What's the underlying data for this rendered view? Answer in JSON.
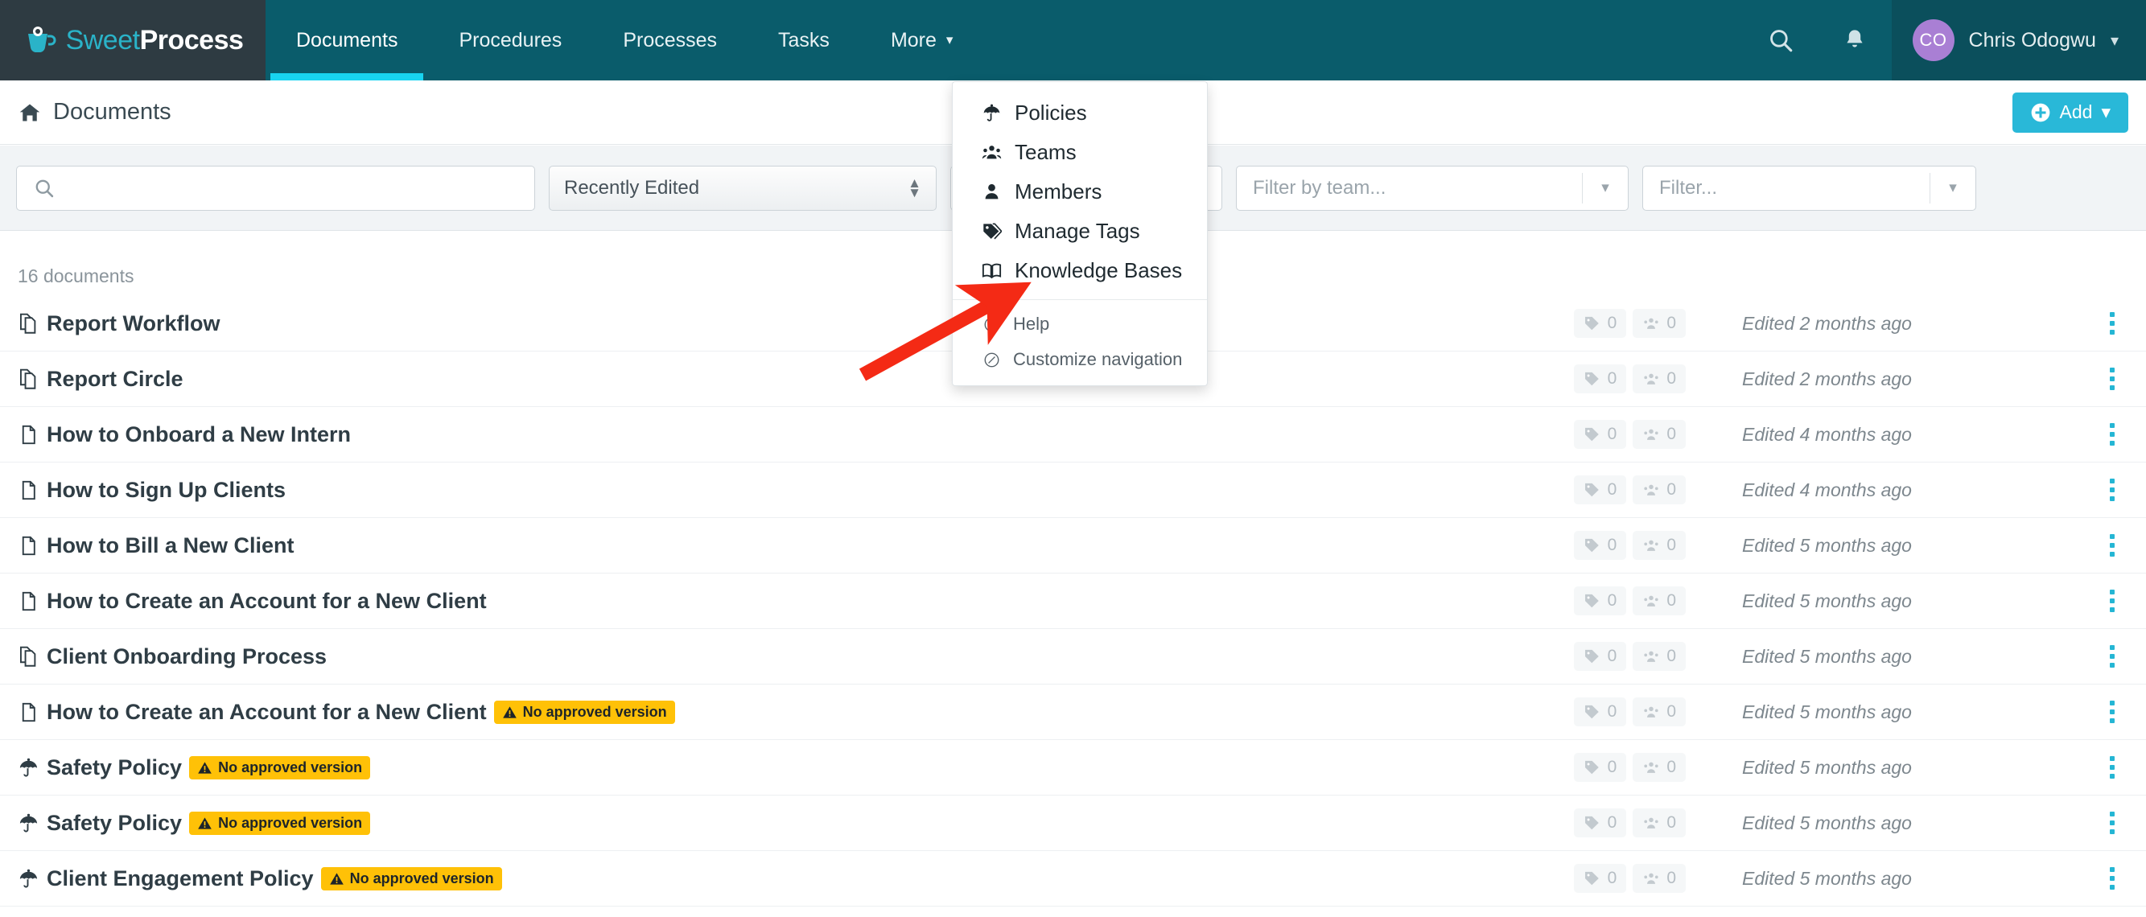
{
  "brand": {
    "name_light": "Sweet",
    "name_bold": "Process",
    "logo_icon": "coffee-cup-icon"
  },
  "topnav": {
    "items": [
      {
        "label": "Documents",
        "active": true
      },
      {
        "label": "Procedures",
        "active": false
      },
      {
        "label": "Processes",
        "active": false
      },
      {
        "label": "Tasks",
        "active": false
      },
      {
        "label": "More",
        "active": false,
        "caret": "▾"
      }
    ],
    "search_icon": "search-icon",
    "bell_icon": "bell-icon",
    "user": {
      "initials": "CO",
      "name": "Chris Odogwu",
      "caret": "▾"
    }
  },
  "breadcrumb": {
    "home_icon": "home-icon",
    "label": "Documents"
  },
  "add_button": {
    "label": "Add",
    "plus_icon": "plus-circle-icon",
    "caret": "▾",
    "color": "#29b8d8"
  },
  "filters": {
    "search": {
      "placeholder": "",
      "value": "",
      "icon": "search-icon"
    },
    "sort": {
      "value": "Recently Edited"
    },
    "tag_filter": {
      "placeholder": ""
    },
    "team_filter": {
      "placeholder": "Filter by team..."
    },
    "other_filter": {
      "placeholder": "Filter..."
    }
  },
  "list": {
    "count_label": "16 documents",
    "badge_text": "No approved version",
    "badge_icon": "warning-triangle-icon",
    "badge_color": "#ffc107",
    "rows": [
      {
        "icon": "process-copy-icon",
        "title": "Report Workflow",
        "badge": false,
        "tags": "0",
        "teams": "0",
        "edited": "Edited 2 months ago"
      },
      {
        "icon": "process-copy-icon",
        "title": "Report Circle",
        "badge": false,
        "tags": "0",
        "teams": "0",
        "edited": "Edited 2 months ago"
      },
      {
        "icon": "document-icon",
        "title": "How to Onboard a New Intern",
        "badge": false,
        "tags": "0",
        "teams": "0",
        "edited": "Edited 4 months ago"
      },
      {
        "icon": "document-icon",
        "title": "How to Sign Up Clients",
        "badge": false,
        "tags": "0",
        "teams": "0",
        "edited": "Edited 4 months ago"
      },
      {
        "icon": "document-icon",
        "title": "How to Bill a New Client",
        "badge": false,
        "tags": "0",
        "teams": "0",
        "edited": "Edited 5 months ago"
      },
      {
        "icon": "document-icon",
        "title": "How to Create an Account for a New Client",
        "badge": false,
        "tags": "0",
        "teams": "0",
        "edited": "Edited 5 months ago"
      },
      {
        "icon": "process-copy-icon",
        "title": "Client Onboarding Process",
        "badge": false,
        "tags": "0",
        "teams": "0",
        "edited": "Edited 5 months ago"
      },
      {
        "icon": "document-icon",
        "title": "How to Create an Account for a New Client",
        "badge": true,
        "tags": "0",
        "teams": "0",
        "edited": "Edited 5 months ago"
      },
      {
        "icon": "policy-umbrella-icon",
        "title": "Safety Policy",
        "badge": true,
        "tags": "0",
        "teams": "0",
        "edited": "Edited 5 months ago"
      },
      {
        "icon": "policy-umbrella-icon",
        "title": "Safety Policy",
        "badge": true,
        "tags": "0",
        "teams": "0",
        "edited": "Edited 5 months ago"
      },
      {
        "icon": "policy-umbrella-icon",
        "title": "Client Engagement Policy",
        "badge": true,
        "tags": "0",
        "teams": "0",
        "edited": "Edited 5 months ago"
      }
    ]
  },
  "more_menu": {
    "items": [
      {
        "label": "Policies",
        "icon": "policy-umbrella-icon",
        "section": "main"
      },
      {
        "label": "Teams",
        "icon": "teams-group-icon",
        "section": "main"
      },
      {
        "label": "Members",
        "icon": "person-icon",
        "section": "main"
      },
      {
        "label": "Manage Tags",
        "icon": "tag-icon",
        "section": "main"
      },
      {
        "label": "Knowledge Bases",
        "icon": "open-book-icon",
        "section": "main"
      },
      {
        "label": "Help",
        "icon": "question-circle-icon",
        "section": "secondary"
      },
      {
        "label": "Customize navigation",
        "icon": "pencil-circle-icon",
        "section": "secondary"
      }
    ]
  },
  "annotation": {
    "arrow_color": "#f42a15",
    "points_to": "Knowledge Bases"
  }
}
